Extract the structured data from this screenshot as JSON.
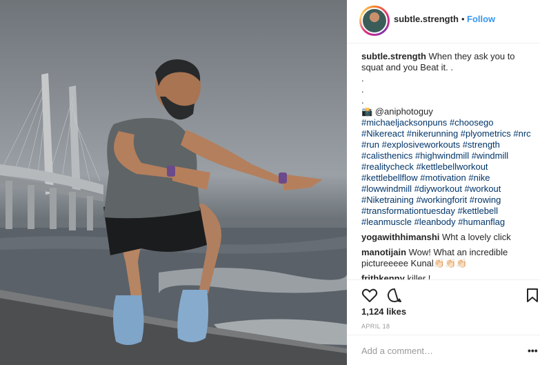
{
  "post": {
    "author": "subtle.strength",
    "dot": "•",
    "follow_label": "Follow",
    "caption": {
      "user": "subtle.strength",
      "text": "When they ask you to squat and you Beat it. .\n.\n.\n.\n📸 @aniphotoguy",
      "hashtags": "#michaeljacksonpuns #choosego #Nikereact #nikerunning #plyometrics #nrc #run #explosiveworkouts #strength #calisthenics #highwindmill #windmill #realitycheck #kettlebellworkout #kettlebellflow #motivation #nike #lowwindmill #diyworkout #workout #Niketraining #workingforit #rowing #transformationtuesday #kettlebell #leanmuscle #leanbody #humanflag"
    },
    "comments": [
      {
        "user": "yogawithhimanshi",
        "text": "Wht a lovely click"
      },
      {
        "user": "manotijain",
        "text": "Wow! What an incredible pictureeeee Kunal👏🏻👏🏻👏🏻"
      },
      {
        "user": "frithkenny",
        "text": "killer !"
      }
    ],
    "likes": "1,124 likes",
    "date": "APRIL 18",
    "add_comment_placeholder": "Add a comment…",
    "more_label": "•••"
  },
  "icons": {
    "like": "heart-icon",
    "comment": "comment-bubble-icon",
    "save": "bookmark-icon",
    "more": "more-options-icon"
  },
  "colors": {
    "link": "#3897f0",
    "hashtag": "#003569",
    "muted": "#999999",
    "text": "#262626"
  }
}
